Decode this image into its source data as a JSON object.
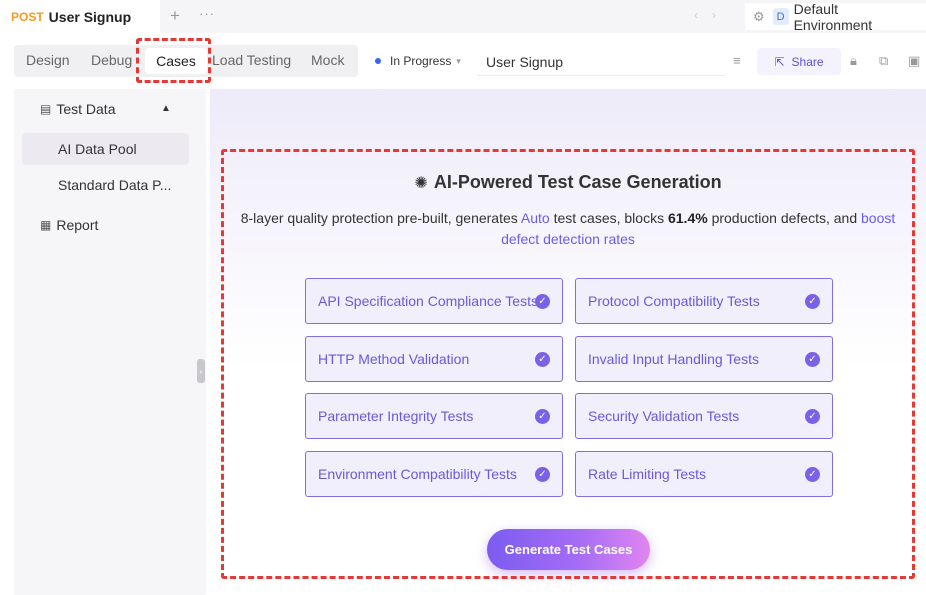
{
  "request_tab": {
    "method": "POST",
    "title": "User Signup"
  },
  "topbar": {
    "new_tab_icon": "plus-icon",
    "more_icon": "more-icon"
  },
  "environment": {
    "badge": "D",
    "name": "Default Environment"
  },
  "mode_tabs": [
    {
      "label": "Design"
    },
    {
      "label": "Debug"
    },
    {
      "label": "Cases",
      "active": true
    },
    {
      "label": "Load Testing"
    },
    {
      "label": "Mock"
    }
  ],
  "status": {
    "label": "In Progress",
    "dot_color": "#3366ff"
  },
  "request_name": {
    "value": "User Signup"
  },
  "share": {
    "label": "Share"
  },
  "sidebar": {
    "group": {
      "label": "Test Data",
      "expanded": true
    },
    "items": [
      {
        "label": "AI Data Pool",
        "active": true
      },
      {
        "label": "Standard Data P..."
      }
    ],
    "report": {
      "label": "Report"
    }
  },
  "main": {
    "title": "AI-Powered Test Case Generation",
    "description": {
      "part1": "8-layer quality protection pre-built, generates ",
      "auto": "Auto",
      "part2": "  test cases, blocks ",
      "percent": "61.4%",
      "part3": " production defects, and ",
      "boost": "boost defect detection rates"
    },
    "features": [
      {
        "label": "API Specification Compliance Tests",
        "checked": true
      },
      {
        "label": "Protocol Compatibility Tests",
        "checked": true
      },
      {
        "label": "HTTP Method Validation",
        "checked": true
      },
      {
        "label": "Invalid Input Handling Tests",
        "checked": true
      },
      {
        "label": "Parameter Integrity Tests",
        "checked": true
      },
      {
        "label": "Security Validation Tests",
        "checked": true
      },
      {
        "label": "Environment Compatibility Tests",
        "checked": true
      },
      {
        "label": "Rate Limiting Tests",
        "checked": true
      }
    ],
    "generate_button": "Generate Test Cases"
  },
  "colors": {
    "accent": "#6b5ce7",
    "method": "#f59a23",
    "highlight": "#e53935"
  }
}
